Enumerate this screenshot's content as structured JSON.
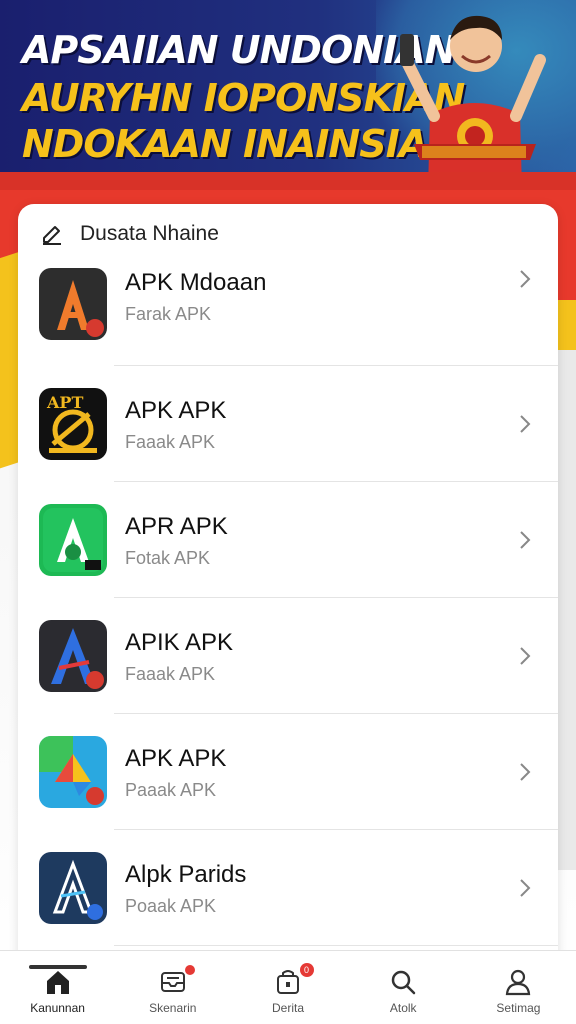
{
  "banner": {
    "line1": "APSAIIAN UNDONIAN",
    "line2": "AURYHN IOPONSKIAN",
    "line3": "NDOKAAN INAINSIAI"
  },
  "card": {
    "title": "Dusata Nhaine"
  },
  "apps": [
    {
      "name": "APK Mdoaan",
      "sub": "Farak APK",
      "icon": "apk-orange-a-icon"
    },
    {
      "name": "APK APK",
      "sub": "Faaak APK",
      "icon": "apk-black-gold-icon"
    },
    {
      "name": "APR APK",
      "sub": "Fotak APK",
      "icon": "apk-green-a-icon"
    },
    {
      "name": "APIK APK",
      "sub": "Faaak APK",
      "icon": "apk-blue-a-icon"
    },
    {
      "name": "APK APK",
      "sub": "Paaak APK",
      "icon": "apk-colorful-icon"
    },
    {
      "name": "Alpk Parids",
      "sub": "Poaak APK",
      "icon": "apk-navy-a-icon"
    }
  ],
  "nav": [
    {
      "label": "Kanunnan",
      "icon": "home-icon"
    },
    {
      "label": "Skenarin",
      "icon": "inbox-icon"
    },
    {
      "label": "Derita",
      "icon": "bag-icon"
    },
    {
      "label": "Atolk",
      "icon": "search-icon"
    },
    {
      "label": "Setimag",
      "icon": "profile-icon"
    }
  ],
  "colors": {
    "banner_bg": "#1f2a78",
    "banner_text_yellow": "#f6c11b",
    "accent_red": "#e7392c"
  }
}
